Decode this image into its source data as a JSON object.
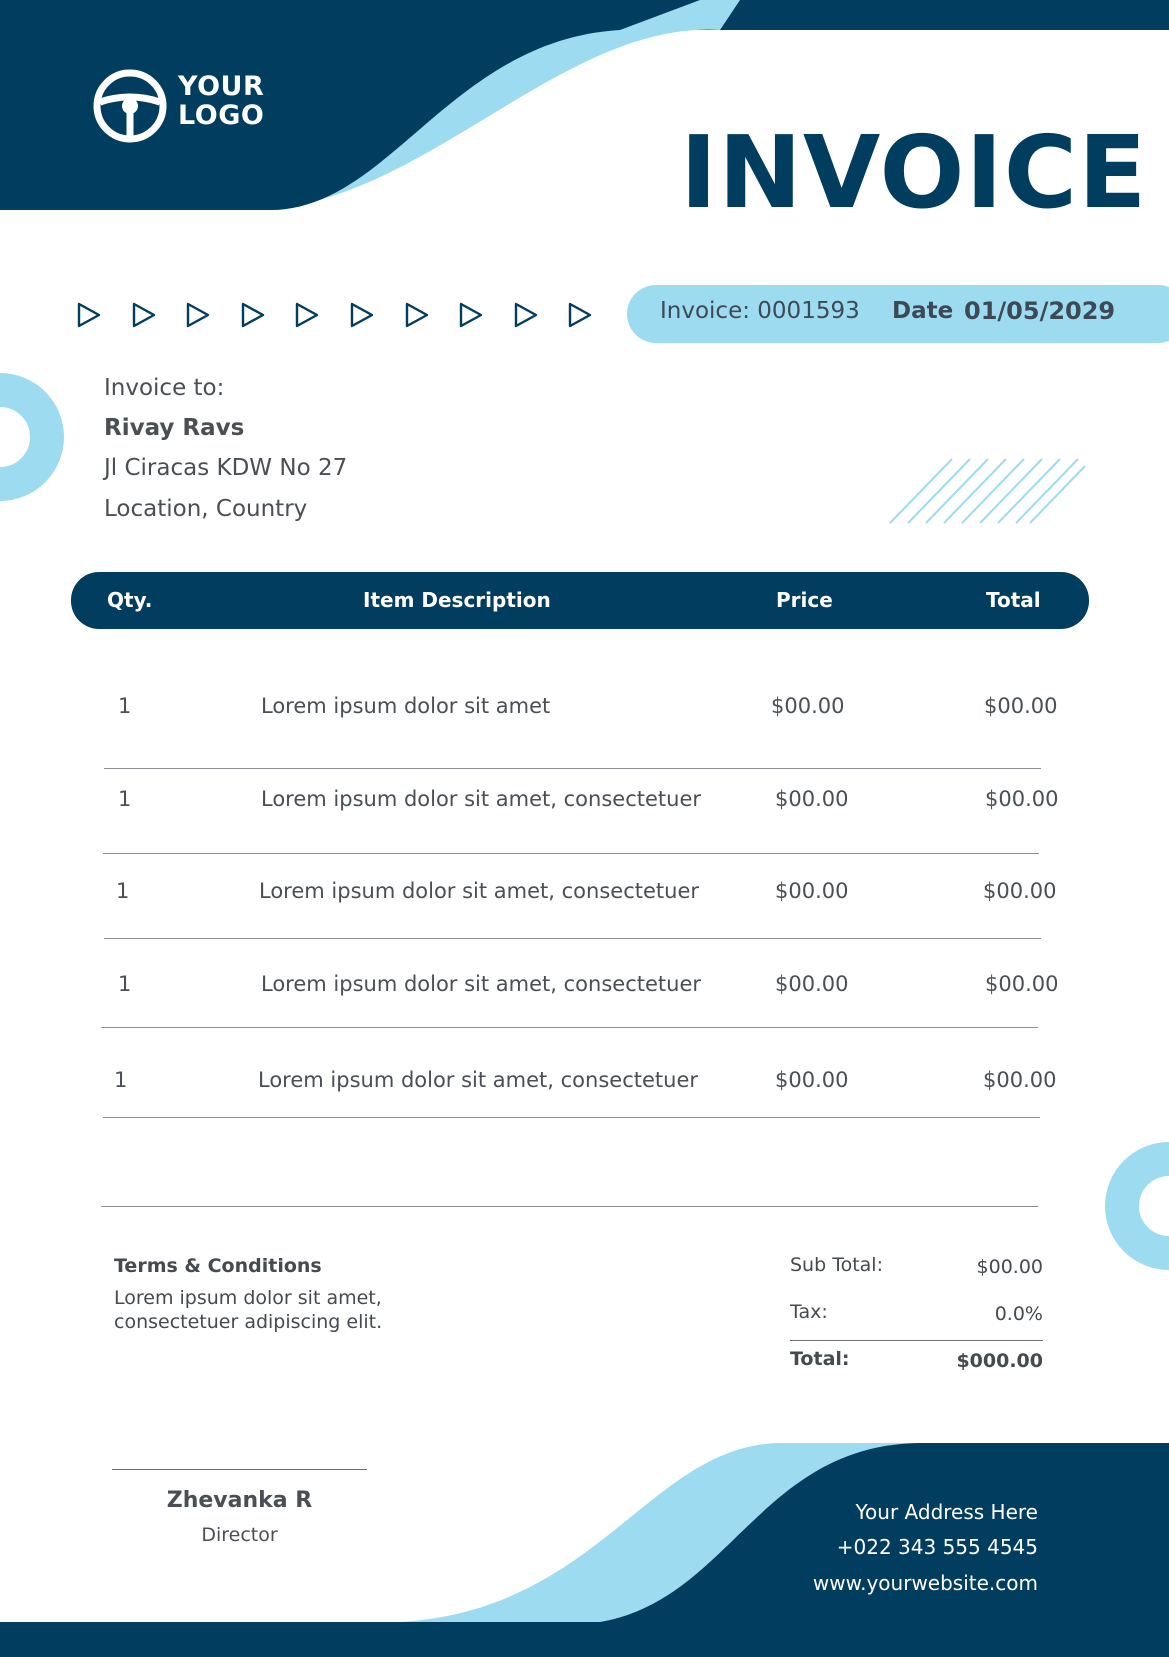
{
  "colors": {
    "navy": "#013d5e",
    "light_blue": "#9ddbf0",
    "text": "#444a50"
  },
  "logo": {
    "icon": "steering-wheel-icon",
    "line1": "YOUR",
    "line2": "LOGO"
  },
  "title": "INVOICE",
  "decor": {
    "arrow_icon": "play-triangle-icon",
    "arrow_count": 10
  },
  "invoice": {
    "number_text": "Invoice: 0001593",
    "date_label": "Date",
    "date_value": "01/05/2029"
  },
  "bill_to": {
    "label": "Invoice to:",
    "name": "Rivay Ravs",
    "address": "Jl Ciracas KDW No 27",
    "location": "Location, Country"
  },
  "table": {
    "headers": {
      "qty": "Qty.",
      "description": "Item Description",
      "price": "Price",
      "total": "Total"
    },
    "rows": [
      {
        "qty": "1",
        "description": "Lorem ipsum dolor sit amet",
        "price": "$00.00",
        "total": "$00.00"
      },
      {
        "qty": "1",
        "description": "Lorem ipsum dolor sit amet, consectetuer",
        "price": "$00.00",
        "total": "$00.00"
      },
      {
        "qty": "1",
        "description": "Lorem ipsum dolor sit amet, consectetuer",
        "price": "$00.00",
        "total": "$00.00"
      },
      {
        "qty": "1",
        "description": "Lorem ipsum dolor sit amet, consectetuer",
        "price": "$00.00",
        "total": "$00.00"
      },
      {
        "qty": "1",
        "description": "Lorem ipsum dolor sit amet, consectetuer",
        "price": "$00.00",
        "total": "$00.00"
      }
    ]
  },
  "terms": {
    "heading": "Terms & Conditions",
    "text": "Lorem ipsum dolor sit amet, consectetuer adipiscing elit."
  },
  "summary": {
    "subtotal_label": "Sub Total:",
    "subtotal_value": "$00.00",
    "tax_label": "Tax:",
    "tax_value": "0.0%",
    "total_label": "Total:",
    "total_value": "$000.00"
  },
  "signature": {
    "name": "Zhevanka R",
    "role": "Director"
  },
  "contact": {
    "address": "Your Address Here",
    "phone": "+022 343 555 4545",
    "website": "www.yourwebsite.com"
  }
}
